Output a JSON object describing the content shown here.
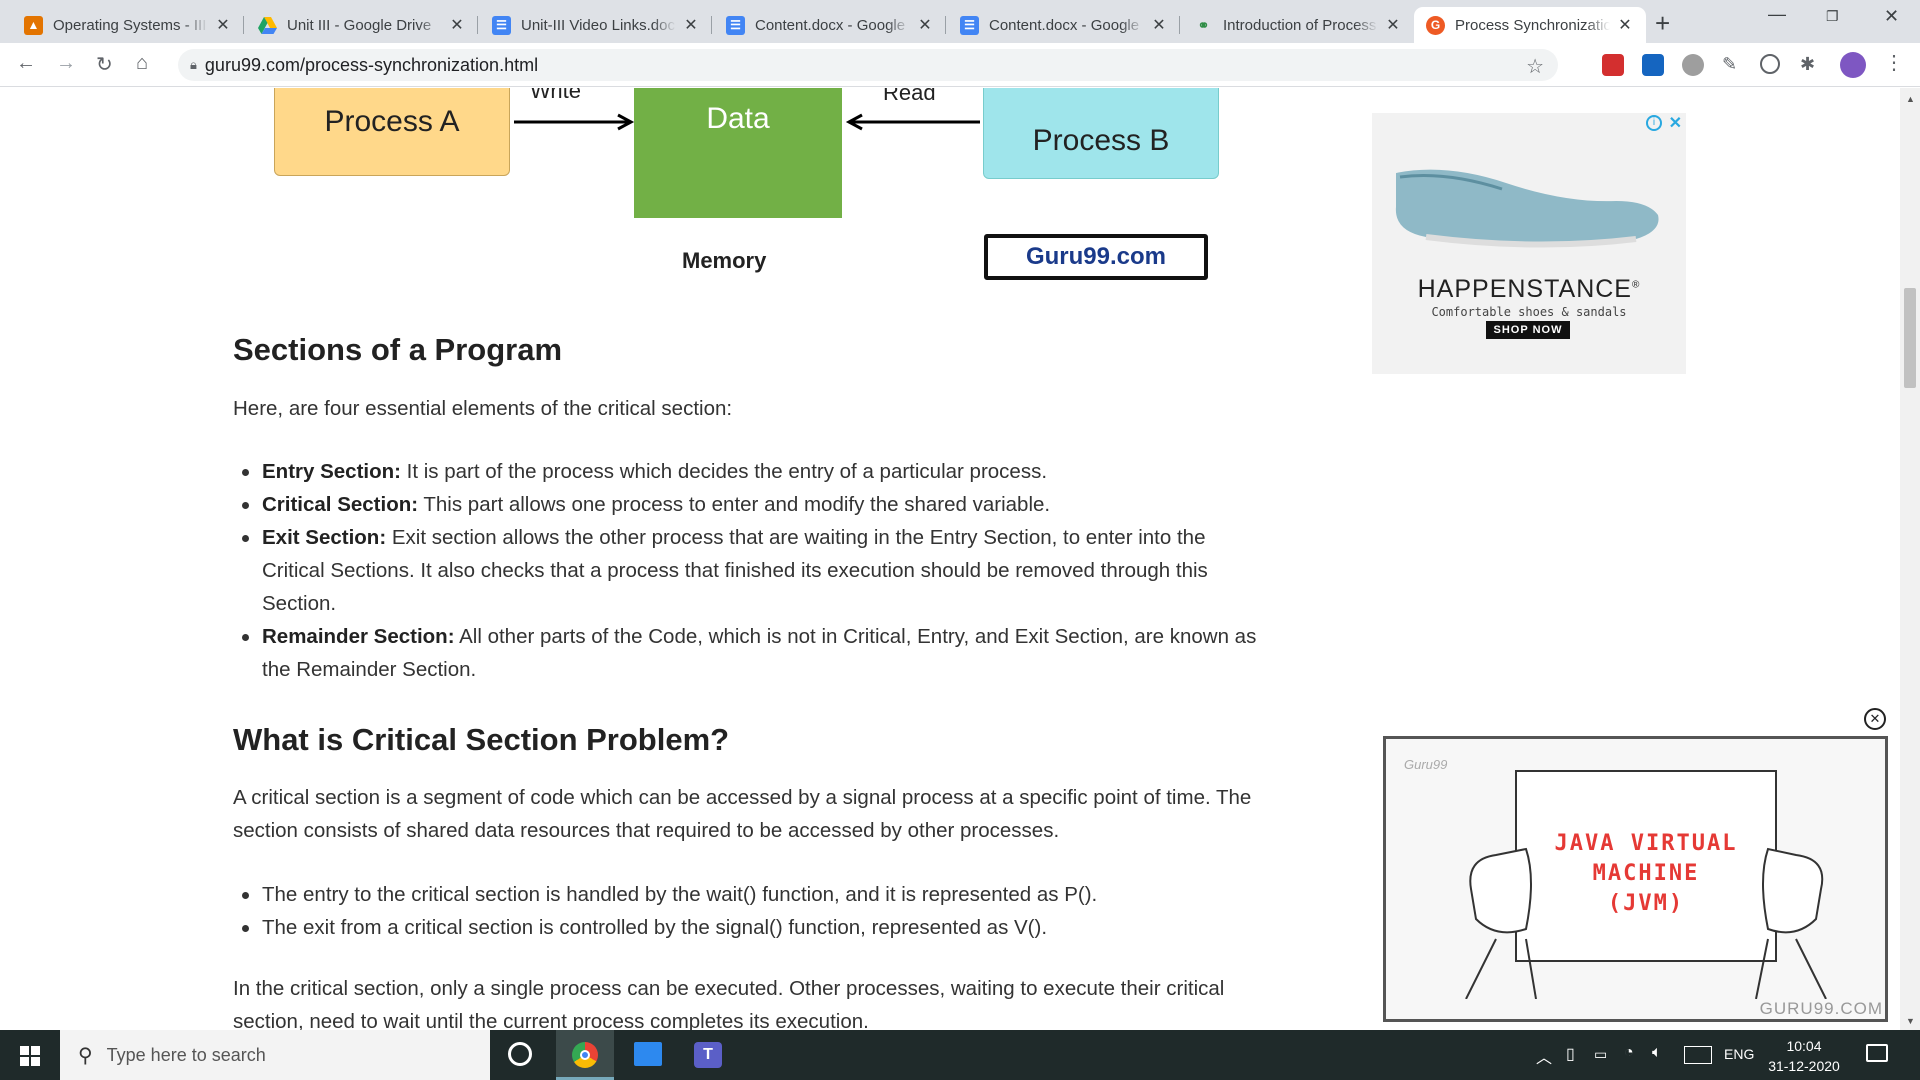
{
  "tabs": [
    {
      "title": "Operating Systems - III",
      "icon": "classroom-icon",
      "color": "#e37400"
    },
    {
      "title": "Unit III - Google Drive",
      "icon": "google-drive-icon",
      "color": "#1fa463"
    },
    {
      "title": "Unit-III Video Links.doc",
      "icon": "google-docs-icon",
      "color": "#4285f4"
    },
    {
      "title": "Content.docx - Google",
      "icon": "google-docs-icon",
      "color": "#4285f4"
    },
    {
      "title": "Content.docx - Google",
      "icon": "google-docs-icon",
      "color": "#4285f4"
    },
    {
      "title": "Introduction of Process",
      "icon": "geeksforgeeks-icon",
      "color": "#2f8d46"
    },
    {
      "title": "Process Synchronizatio",
      "icon": "guru99-icon",
      "color": "#ee5a24"
    }
  ],
  "address": {
    "url": "guru99.com/process-synchronization.html"
  },
  "diagram": {
    "process_a": "Process A",
    "data": "Data",
    "process_b": "Process B",
    "write": "Write",
    "read": "Read",
    "memory": "Memory",
    "logo": "Guru99.com"
  },
  "article": {
    "h_sections": "Sections of a Program",
    "p_intro": "Here, are four essential elements of the critical section:",
    "items": [
      {
        "term": "Entry Section:",
        "text": " It is part of the process which decides the entry of a particular process."
      },
      {
        "term": "Critical Section:",
        "text": " This part allows one process to enter and modify the shared variable."
      },
      {
        "term": "Exit Section:",
        "text": " Exit section allows the other process that are waiting in the Entry Section, to enter into the Critical Sections. It also checks that a process that finished its execution should be removed through this Section."
      },
      {
        "term": "Remainder Section:",
        "text": " All other parts of the Code, which is not in Critical, Entry, and Exit Section, are known as the Remainder Section."
      }
    ],
    "h_problem": "What is Critical Section Problem?",
    "p_problem": "A critical section is a segment of code which can be accessed by a signal process at a specific point of time. The section consists of shared data resources that required to be accessed by other processes.",
    "bullets2": [
      "The entry to the critical section is handled by the wait() function, and it is represented as P().",
      "The exit from a critical section is controlled by the signal() function, represented as V()."
    ],
    "p_last": "In the critical section, only a single process can be executed. Other processes, waiting to execute their critical section, need to wait until the current process completes its execution."
  },
  "ad": {
    "brand": "HAPPENSTANCE",
    "reg": "®",
    "tagline": "Comfortable shoes & sandals",
    "cta": "SHOP NOW"
  },
  "video": {
    "watermark": "Guru99",
    "board_line1": "JAVA VIRTUAL",
    "board_line2": "MACHINE",
    "board_line3": "(JVM)",
    "corner": "GURU99.COM"
  },
  "taskbar": {
    "search_placeholder": "Type here to search",
    "lang": "ENG",
    "time": "10:04",
    "date": "31-12-2020"
  }
}
